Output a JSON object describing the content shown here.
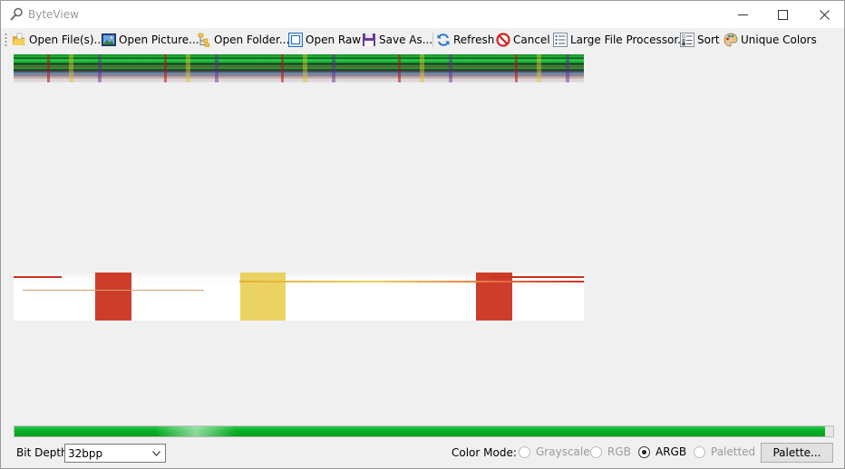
{
  "window": {
    "title": "ByteView"
  },
  "toolbar": {
    "items": [
      {
        "label": "Open File(s)...",
        "icon": "folder-open-icon"
      },
      {
        "label": "Open Picture...",
        "icon": "picture-icon"
      },
      {
        "label": "Open Folder...",
        "icon": "folder-tree-icon"
      },
      {
        "label": "Open Raw",
        "icon": "raw-frame-icon"
      },
      {
        "label": "Save As...",
        "icon": "floppy-disk-icon"
      },
      {
        "label": "Refresh",
        "icon": "refresh-icon"
      },
      {
        "label": "Cancel",
        "icon": "cancel-icon"
      },
      {
        "label": "Large File Processor...",
        "icon": "list-icon"
      },
      {
        "label": "Sort",
        "icon": "sort-icon"
      },
      {
        "label": "Unique Colors",
        "icon": "palette-icon"
      }
    ]
  },
  "progress": {
    "fraction": 0.99
  },
  "bottom": {
    "bit_depth_label": "Bit Depth:",
    "bit_depth_value": "32bpp",
    "color_mode_label": "Color Mode:",
    "modes": [
      {
        "label": "Grayscale",
        "selected": false,
        "enabled": false
      },
      {
        "label": "RGB",
        "selected": false,
        "enabled": false
      },
      {
        "label": "ARGB",
        "selected": true,
        "enabled": true
      },
      {
        "label": "Paletted",
        "selected": false,
        "enabled": false
      }
    ],
    "palette_button": "Palette..."
  },
  "colors": {
    "progress_green": "#06b025",
    "title_gray": "#999999"
  }
}
